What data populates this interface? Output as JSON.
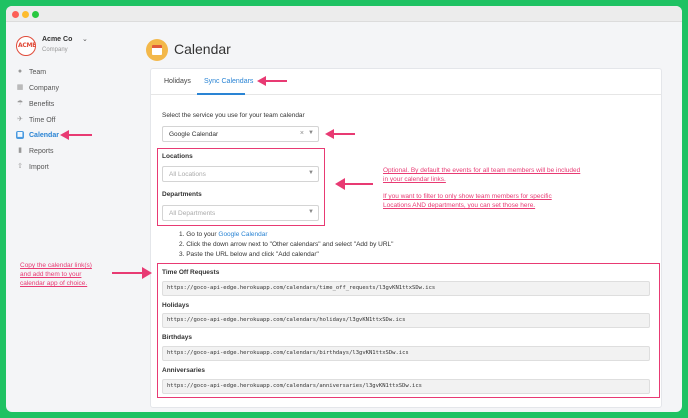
{
  "window": {
    "controls": [
      "close",
      "minimize",
      "maximize"
    ]
  },
  "brand": {
    "logo_text": "ACME",
    "name": "Acme Co",
    "subtitle": "Company"
  },
  "sidebar": {
    "items": [
      {
        "label": "Team",
        "icon": "team-icon"
      },
      {
        "label": "Company",
        "icon": "company-icon"
      },
      {
        "label": "Benefits",
        "icon": "umbrella-icon"
      },
      {
        "label": "Time Off",
        "icon": "plane-icon"
      },
      {
        "label": "Calendar",
        "icon": "calendar-icon",
        "active": true
      },
      {
        "label": "Reports",
        "icon": "bar-chart-icon"
      },
      {
        "label": "Import",
        "icon": "upload-icon"
      }
    ]
  },
  "page": {
    "title": "Calendar"
  },
  "tabs": [
    {
      "label": "Holidays",
      "active": false
    },
    {
      "label": "Sync Calendars",
      "active": true
    }
  ],
  "service": {
    "label": "Select the service you use for your team calendar",
    "value": "Google Calendar"
  },
  "filters": {
    "locations_label": "Locations",
    "locations_placeholder": "All Locations",
    "departments_label": "Departments",
    "departments_placeholder": "All Departments"
  },
  "steps": {
    "step1_prefix": "1. Go to your ",
    "step1_link": "Google Calendar",
    "step2": "2. Click the down arrow next to \"Other calendars\" and select \"Add by URL\"",
    "step3": "3. Paste the URL below and click \"Add calendar\""
  },
  "calendars": [
    {
      "label": "Time Off Requests",
      "url": "https://goco-api-edge.herokuapp.com/calendars/time_off_requests/l3gvKN1ttxSDw.ics"
    },
    {
      "label": "Holidays",
      "url": "https://goco-api-edge.herokuapp.com/calendars/holidays/l3gvKN1ttxSDw.ics"
    },
    {
      "label": "Birthdays",
      "url": "https://goco-api-edge.herokuapp.com/calendars/birthdays/l3gvKN1ttxSDw.ics"
    },
    {
      "label": "Anniversaries",
      "url": "https://goco-api-edge.herokuapp.com/calendars/anniversaries/l3gvKN1ttxSDw.ics"
    }
  ],
  "annotations": {
    "optional_1": "Optional.  By default the events for all team members will be included",
    "optional_2": "in your calendar links.",
    "filter_1": "If you want to filter to only show team members for specific",
    "filter_2": "Locations AND departments, you can set those here.",
    "copy_1": "Copy the calendar link(s)",
    "copy_2": "and add them to your",
    "copy_3": "calendar app of choice."
  },
  "colors": {
    "accent": "#2a84d4",
    "annotation": "#e83a73",
    "background": "#1fc263"
  }
}
